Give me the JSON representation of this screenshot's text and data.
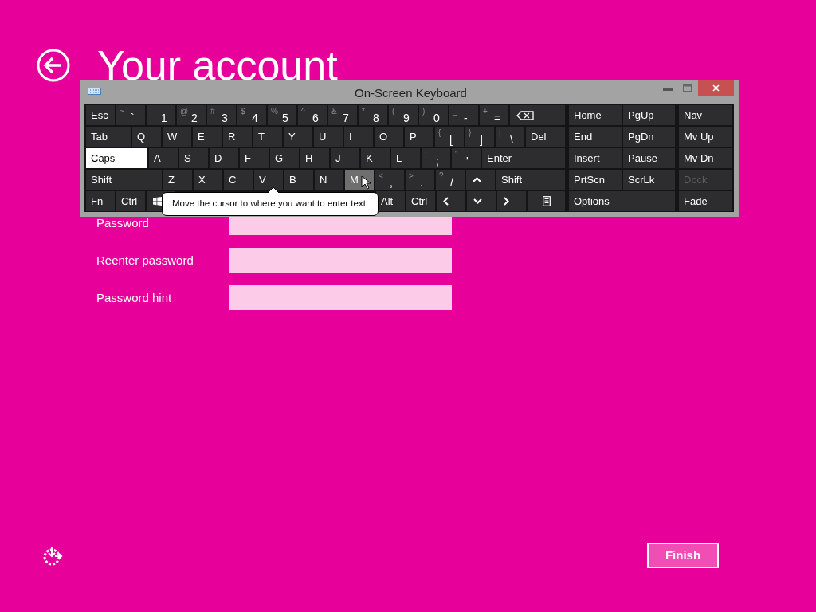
{
  "page": {
    "title": "Your account"
  },
  "form": {
    "fields": [
      {
        "label": "Password"
      },
      {
        "label": "Reenter password"
      },
      {
        "label": "Password hint"
      }
    ]
  },
  "keyboard": {
    "title": "On-Screen Keyboard",
    "main_rows": [
      [
        {
          "kind": "text",
          "label": "Esc",
          "on": false,
          "hovered": false,
          "disabled": false
        },
        {
          "kind": "char",
          "shift": "~",
          "label": "`",
          "on": false,
          "hovered": false,
          "disabled": false
        },
        {
          "kind": "char",
          "shift": "!",
          "label": "1",
          "on": false,
          "hovered": false,
          "disabled": false
        },
        {
          "kind": "char",
          "shift": "@",
          "label": "2",
          "on": false,
          "hovered": false,
          "disabled": false
        },
        {
          "kind": "char",
          "shift": "#",
          "label": "3",
          "on": false,
          "hovered": false,
          "disabled": false
        },
        {
          "kind": "char",
          "shift": "$",
          "label": "4",
          "on": false,
          "hovered": false,
          "disabled": false
        },
        {
          "kind": "char",
          "shift": "%",
          "label": "5",
          "on": false,
          "hovered": false,
          "disabled": false
        },
        {
          "kind": "char",
          "shift": "^",
          "label": "6",
          "on": false,
          "hovered": false,
          "disabled": false
        },
        {
          "kind": "char",
          "shift": "&",
          "label": "7",
          "on": false,
          "hovered": false,
          "disabled": false
        },
        {
          "kind": "char",
          "shift": "*",
          "label": "8",
          "on": false,
          "hovered": false,
          "disabled": false
        },
        {
          "kind": "char",
          "shift": "(",
          "label": "9",
          "on": false,
          "hovered": false,
          "disabled": false
        },
        {
          "kind": "char",
          "shift": ")",
          "label": "0",
          "on": false,
          "hovered": false,
          "disabled": false
        },
        {
          "kind": "char",
          "shift": "_",
          "label": "-",
          "on": false,
          "hovered": false,
          "disabled": false
        },
        {
          "kind": "char",
          "shift": "+",
          "label": "=",
          "on": false,
          "hovered": false,
          "disabled": false
        },
        {
          "kind": "backspace",
          "on": false,
          "hovered": false,
          "disabled": false
        }
      ],
      [
        {
          "kind": "text",
          "label": "Tab",
          "on": false,
          "hovered": false,
          "disabled": false
        },
        {
          "kind": "text",
          "label": "Q",
          "on": false,
          "hovered": false,
          "disabled": false
        },
        {
          "kind": "text",
          "label": "W",
          "on": false,
          "hovered": false,
          "disabled": false
        },
        {
          "kind": "text",
          "label": "E",
          "on": false,
          "hovered": false,
          "disabled": false
        },
        {
          "kind": "text",
          "label": "R",
          "on": false,
          "hovered": false,
          "disabled": false
        },
        {
          "kind": "text",
          "label": "T",
          "on": false,
          "hovered": false,
          "disabled": false
        },
        {
          "kind": "text",
          "label": "Y",
          "on": false,
          "hovered": false,
          "disabled": false
        },
        {
          "kind": "text",
          "label": "U",
          "on": false,
          "hovered": false,
          "disabled": false
        },
        {
          "kind": "text",
          "label": "I",
          "on": false,
          "hovered": false,
          "disabled": false
        },
        {
          "kind": "text",
          "label": "O",
          "on": false,
          "hovered": false,
          "disabled": false
        },
        {
          "kind": "text",
          "label": "P",
          "on": false,
          "hovered": false,
          "disabled": false
        },
        {
          "kind": "char",
          "shift": "{",
          "label": "[",
          "on": false,
          "hovered": false,
          "disabled": false
        },
        {
          "kind": "char",
          "shift": "}",
          "label": "]",
          "on": false,
          "hovered": false,
          "disabled": false
        },
        {
          "kind": "char",
          "shift": "|",
          "label": "\\",
          "on": false,
          "hovered": false,
          "disabled": false
        },
        {
          "kind": "text",
          "label": "Del",
          "on": false,
          "hovered": false,
          "disabled": false
        }
      ],
      [
        {
          "kind": "text",
          "label": "Caps",
          "on": true,
          "hovered": false,
          "disabled": false
        },
        {
          "kind": "text",
          "label": "A",
          "on": false,
          "hovered": false,
          "disabled": false
        },
        {
          "kind": "text",
          "label": "S",
          "on": false,
          "hovered": false,
          "disabled": false
        },
        {
          "kind": "text",
          "label": "D",
          "on": false,
          "hovered": false,
          "disabled": false
        },
        {
          "kind": "text",
          "label": "F",
          "on": false,
          "hovered": false,
          "disabled": false
        },
        {
          "kind": "text",
          "label": "G",
          "on": false,
          "hovered": false,
          "disabled": false
        },
        {
          "kind": "text",
          "label": "H",
          "on": false,
          "hovered": false,
          "disabled": false
        },
        {
          "kind": "text",
          "label": "J",
          "on": false,
          "hovered": false,
          "disabled": false
        },
        {
          "kind": "text",
          "label": "K",
          "on": false,
          "hovered": false,
          "disabled": false
        },
        {
          "kind": "text",
          "label": "L",
          "on": false,
          "hovered": false,
          "disabled": false
        },
        {
          "kind": "char",
          "shift": ":",
          "label": ";",
          "on": false,
          "hovered": false,
          "disabled": false
        },
        {
          "kind": "char",
          "shift": "\"",
          "label": "'",
          "on": false,
          "hovered": false,
          "disabled": false
        },
        {
          "kind": "text",
          "label": "Enter",
          "on": false,
          "hovered": false,
          "disabled": false
        }
      ],
      [
        {
          "kind": "text",
          "label": "Shift",
          "on": false,
          "hovered": false,
          "disabled": false
        },
        {
          "kind": "text",
          "label": "Z",
          "on": false,
          "hovered": false,
          "disabled": false
        },
        {
          "kind": "text",
          "label": "X",
          "on": false,
          "hovered": false,
          "disabled": false
        },
        {
          "kind": "text",
          "label": "C",
          "on": false,
          "hovered": false,
          "disabled": false
        },
        {
          "kind": "text",
          "label": "V",
          "on": false,
          "hovered": false,
          "disabled": false
        },
        {
          "kind": "text",
          "label": "B",
          "on": false,
          "hovered": false,
          "disabled": false
        },
        {
          "kind": "text",
          "label": "N",
          "on": false,
          "hovered": false,
          "disabled": false
        },
        {
          "kind": "text",
          "label": "M",
          "on": false,
          "hovered": true,
          "disabled": false
        },
        {
          "kind": "char",
          "shift": "<",
          "label": ",",
          "on": false,
          "hovered": false,
          "disabled": false
        },
        {
          "kind": "char",
          "shift": ">",
          "label": ".",
          "on": false,
          "hovered": false,
          "disabled": false
        },
        {
          "kind": "char",
          "shift": "?",
          "label": "/",
          "on": false,
          "hovered": false,
          "disabled": false
        },
        {
          "kind": "up",
          "on": false,
          "hovered": false,
          "disabled": false
        },
        {
          "kind": "text",
          "label": "Shift",
          "on": false,
          "hovered": false,
          "disabled": false
        }
      ],
      [
        {
          "kind": "text",
          "label": "Fn",
          "on": false,
          "hovered": false,
          "disabled": false
        },
        {
          "kind": "text",
          "label": "Ctrl",
          "on": false,
          "hovered": false,
          "disabled": false
        },
        {
          "kind": "windows",
          "on": false,
          "hovered": false,
          "disabled": false
        },
        {
          "kind": "text",
          "label": "Alt",
          "on": false,
          "hovered": false,
          "disabled": false
        },
        {
          "kind": "text",
          "label": "Ctrl",
          "on": false,
          "hovered": false,
          "disabled": false
        },
        {
          "kind": "left",
          "on": false,
          "hovered": false,
          "disabled": false
        },
        {
          "kind": "down",
          "on": false,
          "hovered": false,
          "disabled": false
        },
        {
          "kind": "right",
          "on": false,
          "hovered": false,
          "disabled": false
        },
        {
          "kind": "menu",
          "on": false,
          "hovered": false,
          "disabled": false
        }
      ]
    ],
    "side_rows": [
      [
        {
          "kind": "text",
          "label": "Home",
          "on": false,
          "hovered": false,
          "disabled": false
        },
        {
          "kind": "text",
          "label": "PgUp",
          "on": false,
          "hovered": false,
          "disabled": false
        },
        {
          "kind": "text",
          "label": "Nav",
          "on": false,
          "hovered": false,
          "disabled": false
        }
      ],
      [
        {
          "kind": "text",
          "label": "End",
          "on": false,
          "hovered": false,
          "disabled": false
        },
        {
          "kind": "text",
          "label": "PgDn",
          "on": false,
          "hovered": false,
          "disabled": false
        },
        {
          "kind": "text",
          "label": "Mv Up",
          "on": false,
          "hovered": false,
          "disabled": false
        }
      ],
      [
        {
          "kind": "text",
          "label": "Insert",
          "on": false,
          "hovered": false,
          "disabled": false
        },
        {
          "kind": "text",
          "label": "Pause",
          "on": false,
          "hovered": false,
          "disabled": false
        },
        {
          "kind": "text",
          "label": "Mv Dn",
          "on": false,
          "hovered": false,
          "disabled": false
        }
      ],
      [
        {
          "kind": "text",
          "label": "PrtScn",
          "on": false,
          "hovered": false,
          "disabled": false
        },
        {
          "kind": "text",
          "label": "ScrLk",
          "on": false,
          "hovered": false,
          "disabled": false
        },
        {
          "kind": "text",
          "label": "Dock",
          "on": false,
          "hovered": false,
          "disabled": true
        }
      ],
      [
        {
          "kind": "text",
          "label": "Options",
          "on": false,
          "hovered": false,
          "disabled": false
        },
        {
          "kind": "text",
          "label": "Fade",
          "on": false,
          "hovered": false,
          "disabled": false
        }
      ]
    ],
    "tooltip": "Move the cursor to where you want to enter text."
  },
  "finish_button": "Finish"
}
